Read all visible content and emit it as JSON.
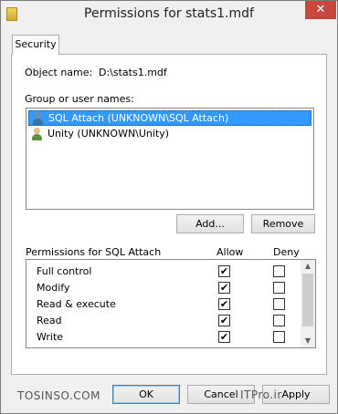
{
  "window": {
    "title": "Permissions for stats1.mdf"
  },
  "tabs": [
    {
      "label": "Security"
    }
  ],
  "object": {
    "label": "Object name:",
    "value": "D:\\stats1.mdf"
  },
  "groups": {
    "label": "Group or user names:",
    "items": [
      {
        "label": "SQL Attach (UNKNOWN\\SQL Attach)",
        "selected": true
      },
      {
        "label": "Unity (UNKNOWN\\Unity)",
        "selected": false
      }
    ]
  },
  "buttons": {
    "add": "Add...",
    "remove": "Remove",
    "ok": "OK",
    "cancel": "Cancel",
    "apply": "Apply"
  },
  "permissions": {
    "label": "Permissions for SQL Attach",
    "allow_header": "Allow",
    "deny_header": "Deny",
    "rows": [
      {
        "name": "Full control",
        "allow": true,
        "deny": false
      },
      {
        "name": "Modify",
        "allow": true,
        "deny": false
      },
      {
        "name": "Read & execute",
        "allow": true,
        "deny": false
      },
      {
        "name": "Read",
        "allow": true,
        "deny": false
      },
      {
        "name": "Write",
        "allow": true,
        "deny": false
      }
    ]
  },
  "watermark": {
    "left": "TOSINSO.COM",
    "right": "ITPro.ir"
  },
  "colors": {
    "selection": "#3399ff",
    "close": "#c9473e"
  }
}
